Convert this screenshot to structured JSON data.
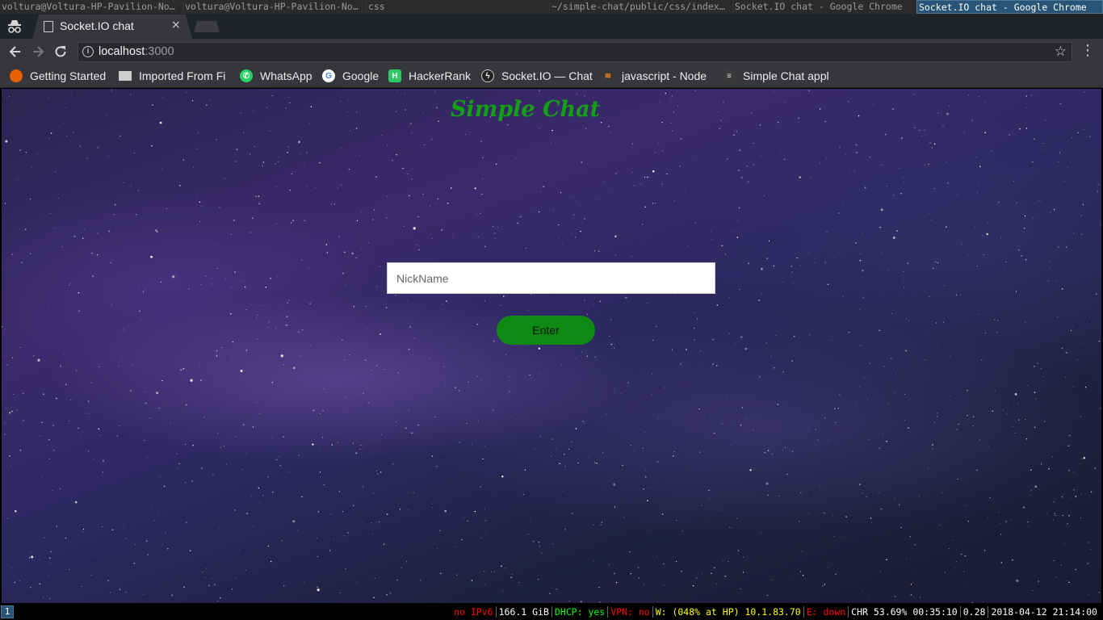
{
  "wm": {
    "tabs": [
      {
        "title": "voltura@Voltura-HP-Pavilion-No…",
        "focused": false
      },
      {
        "title": "voltura@Voltura-HP-Pavilion-No…",
        "focused": false
      },
      {
        "title": "css",
        "focused": false
      },
      {
        "title": "~/simple-chat/public/css/index…",
        "focused": false
      },
      {
        "title": "Socket.IO chat - Google Chrome",
        "focused": false
      },
      {
        "title": "Socket.IO chat - Google Chrome",
        "focused": true
      }
    ]
  },
  "browser": {
    "tab_title": "Socket.IO chat",
    "tab_close": "×",
    "url_host": "localhost",
    "url_port": ":3000",
    "info_icon": "i"
  },
  "bookmarks": [
    {
      "label": "Getting Started",
      "icon": "firefox-icon",
      "color": "#e66000"
    },
    {
      "label": "Imported From Fi",
      "icon": "folder-icon",
      "color": "#d0d0d0"
    },
    {
      "label": "WhatsApp",
      "icon": "whatsapp-icon",
      "color": "#25d366"
    },
    {
      "label": "Google",
      "icon": "google-icon",
      "color": "#ffffff"
    },
    {
      "label": "HackerRank",
      "icon": "hackerrank-icon",
      "color": "#2ec866"
    },
    {
      "label": "Socket.IO — Chat",
      "icon": "socketio-icon",
      "color": "#333333"
    },
    {
      "label": "javascript - Node",
      "icon": "stackoverflow-icon",
      "color": "#f48024"
    },
    {
      "label": "Simple Chat appl",
      "icon": "page-icon",
      "color": "#444444"
    }
  ],
  "page": {
    "title": "Simple Chat",
    "nick_placeholder": "NickName",
    "nick_value": "",
    "enter_label": "Enter"
  },
  "statusbar": {
    "workspace": "1",
    "items": [
      {
        "text": "no IPv6",
        "color": "#ff0000"
      },
      {
        "text": "166.1 GiB",
        "color": "#ffffff"
      },
      {
        "text": "DHCP: yes",
        "color": "#00ff00"
      },
      {
        "text": "VPN: no",
        "color": "#ff0000"
      },
      {
        "text": "W: (048% at HP) 10.1.83.70",
        "color": "#ffff00"
      },
      {
        "text": "E: down",
        "color": "#ff0000"
      },
      {
        "text": "CHR 53.69% 00:35:10",
        "color": "#ffffff"
      },
      {
        "text": "0.28",
        "color": "#ffffff"
      },
      {
        "text": "2018-04-12 21:14:00",
        "color": "#ffffff"
      }
    ]
  },
  "colors": {
    "title_green": "#14a014",
    "button_green": "#0e8a14",
    "wm_focus": "#285577"
  }
}
